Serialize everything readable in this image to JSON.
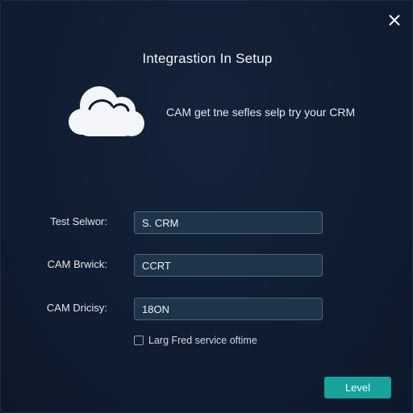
{
  "dialog": {
    "title": "Integrastion In Setup",
    "description": "CAM get tne sefles selp try your CRM",
    "close_icon": "close-icon",
    "cloud_icon": "cloud-icon"
  },
  "fields": [
    {
      "label": "Test Selwor:",
      "value": "S. CRM"
    },
    {
      "label": "CAM Brwick:",
      "value": "CCRT"
    },
    {
      "label": "CAM Dricisy:",
      "value": "18ON"
    }
  ],
  "checkbox": {
    "label": "Larg Fred service oftime",
    "checked": false
  },
  "primary_button": {
    "label": "Level"
  },
  "colors": {
    "background": "#101d31",
    "accent": "#17a39c",
    "input_bg": "#1e3449",
    "input_border": "#4d6780"
  }
}
